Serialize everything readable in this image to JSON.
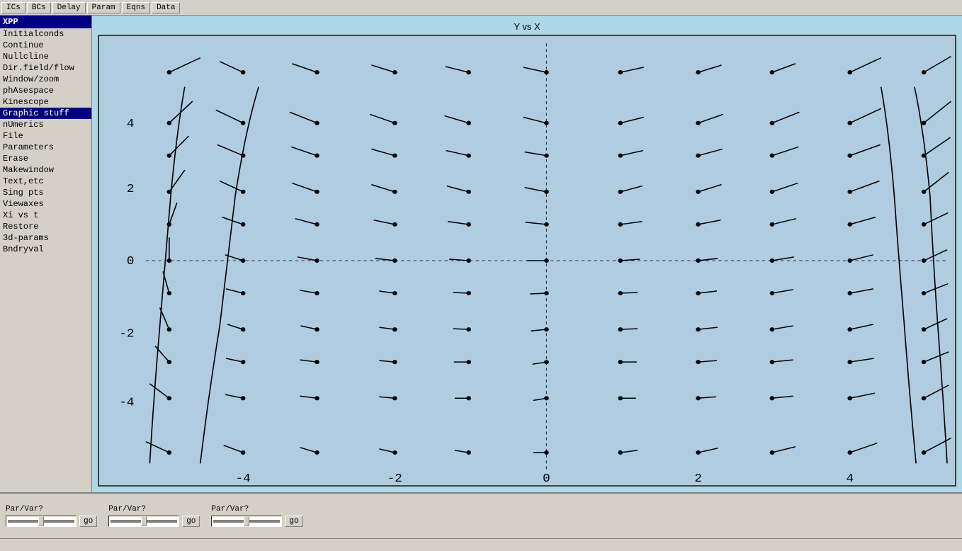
{
  "toolbar": {
    "buttons": [
      "ICs",
      "BCs",
      "Delay",
      "Param",
      "Eqns",
      "Data"
    ]
  },
  "sidebar": {
    "title": "XPP",
    "items": [
      {
        "label": "Initialconds",
        "active": false
      },
      {
        "label": "Continue",
        "active": false
      },
      {
        "label": "Nullcline",
        "active": false
      },
      {
        "label": "Dir.field/flow",
        "active": false
      },
      {
        "label": "Window/zoom",
        "active": false
      },
      {
        "label": "phAsespace",
        "active": false
      },
      {
        "label": "Kinescope",
        "active": false
      },
      {
        "label": "Graphic stuff",
        "active": true
      },
      {
        "label": "nUmerics",
        "active": false
      },
      {
        "label": "File",
        "active": false
      },
      {
        "label": "Parameters",
        "active": false
      },
      {
        "label": "Erase",
        "active": false
      },
      {
        "label": "Makewindow",
        "active": false
      },
      {
        "label": "Text,etc",
        "active": false
      },
      {
        "label": "Sing pts",
        "active": false
      },
      {
        "label": "Viewaxes",
        "active": false
      },
      {
        "label": "Xi vs t",
        "active": false
      },
      {
        "label": "Restore",
        "active": false
      },
      {
        "label": "3d-params",
        "active": false
      },
      {
        "label": "Bndryval",
        "active": false
      }
    ]
  },
  "plot": {
    "title": "Y vs X",
    "x_axis": {
      "min": -5,
      "max": 5,
      "ticks": [
        -4,
        -2,
        0,
        2,
        4
      ]
    },
    "y_axis": {
      "min": -5,
      "max": 5,
      "ticks": [
        -4,
        -2,
        0,
        2,
        4
      ]
    }
  },
  "bottom": {
    "params": [
      {
        "label": "Par/Var?",
        "go": "go"
      },
      {
        "label": "Par/Var?",
        "go": "go"
      },
      {
        "label": "Par/Var?",
        "go": "go"
      }
    ]
  }
}
